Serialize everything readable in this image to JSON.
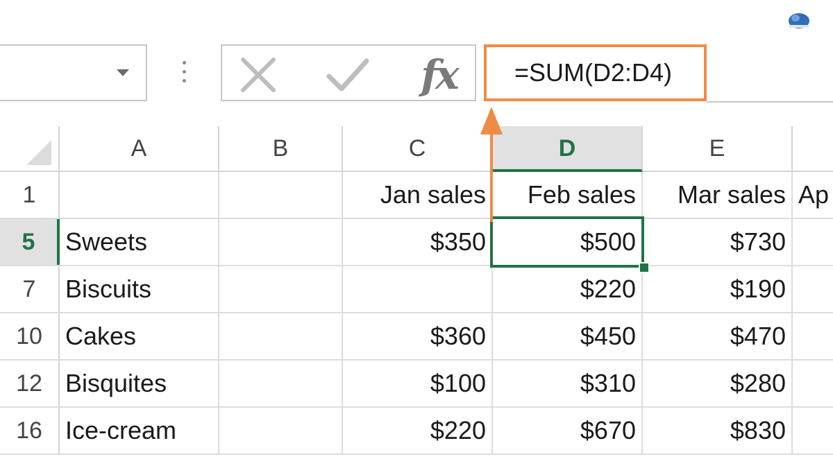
{
  "formula_bar": {
    "name_box_value": "",
    "formula": "=SUM(D2:D4)"
  },
  "columns": [
    {
      "id": "A",
      "label": "A",
      "active": false
    },
    {
      "id": "B",
      "label": "B",
      "active": false
    },
    {
      "id": "C",
      "label": "C",
      "active": false
    },
    {
      "id": "D",
      "label": "D",
      "active": true
    },
    {
      "id": "E",
      "label": "E",
      "active": false
    }
  ],
  "rows": [
    {
      "num": "1",
      "active": false,
      "cells": {
        "A": "",
        "B": "",
        "C": "Jan sales",
        "D": "Feb sales",
        "E": "Mar sales",
        "F": "Ap"
      }
    },
    {
      "num": "5",
      "active": true,
      "cells": {
        "A": "Sweets",
        "B": "",
        "C": "$350",
        "D": "$500",
        "E": "$730",
        "F": ""
      }
    },
    {
      "num": "7",
      "active": false,
      "cells": {
        "A": "Biscuits",
        "B": "",
        "C": "",
        "D": "$220",
        "E": "$190",
        "F": ""
      }
    },
    {
      "num": "10",
      "active": false,
      "cells": {
        "A": "Cakes",
        "B": "",
        "C": "$360",
        "D": "$450",
        "E": "$470",
        "F": ""
      }
    },
    {
      "num": "12",
      "active": false,
      "cells": {
        "A": "Bisquites",
        "B": "",
        "C": "$100",
        "D": "$310",
        "E": "$280",
        "F": ""
      }
    },
    {
      "num": "16",
      "active": false,
      "cells": {
        "A": "Ice-cream",
        "B": "",
        "C": "$220",
        "D": "$670",
        "E": "$830",
        "F": ""
      }
    }
  ],
  "colors": {
    "accent_green": "#217346",
    "formula_highlight": "#f08b43",
    "grid_line": "#dcdcdc"
  },
  "icons": {
    "cancel": "close-icon",
    "enter": "check-icon",
    "insert_function": "fx-icon",
    "name_box_dropdown": "chevron-down-icon",
    "ribbon": "cloud-icon"
  }
}
